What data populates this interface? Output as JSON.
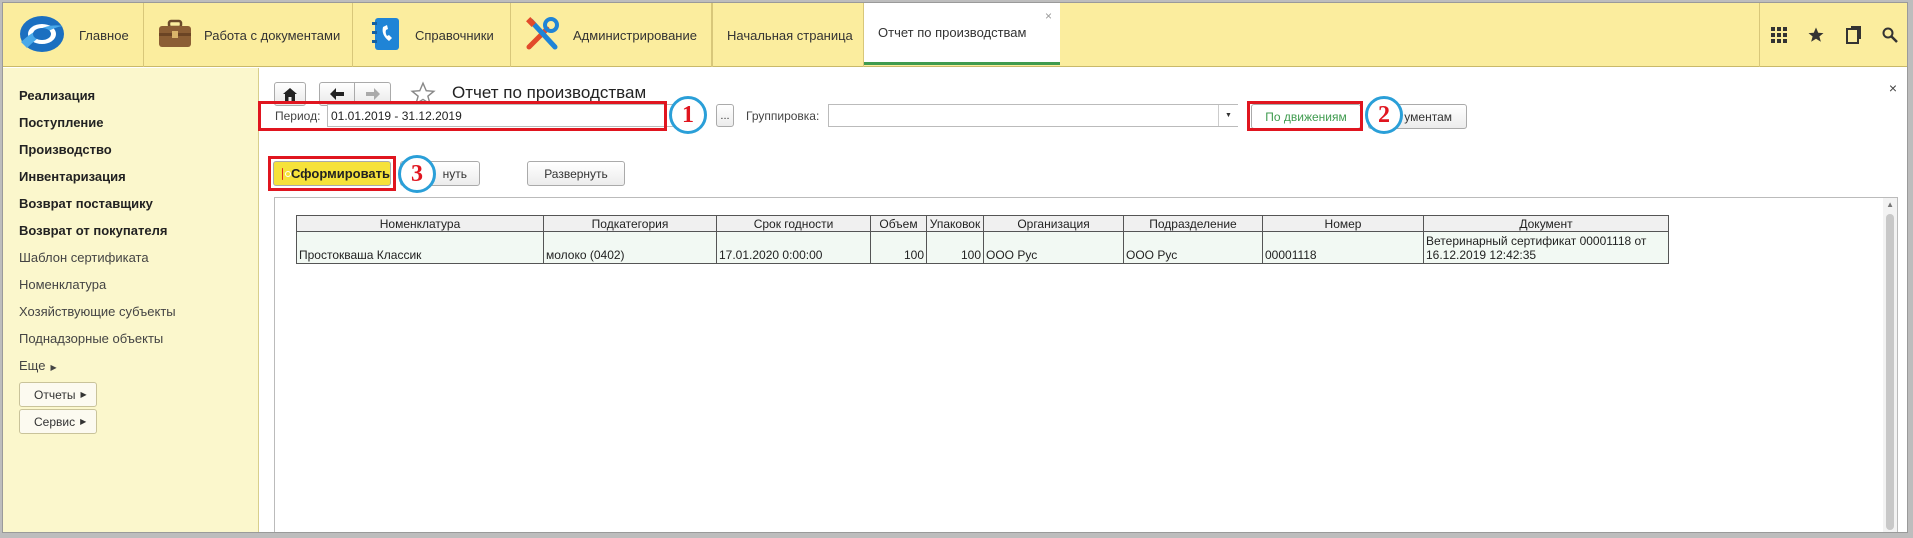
{
  "topbar": {
    "sections": [
      {
        "id": "main",
        "label": "Главное",
        "icon": "app-logo-icon"
      },
      {
        "id": "docs",
        "label": "Работа с документами",
        "icon": "briefcase-icon"
      },
      {
        "id": "refs",
        "label": "Справочники",
        "icon": "address-book-icon"
      },
      {
        "id": "admin",
        "label": "Администрирование",
        "icon": "tools-icon"
      }
    ],
    "tabs": [
      {
        "label": "Начальная страница"
      },
      {
        "label": "Отчет по производствам",
        "close": "×"
      }
    ],
    "right_icons": [
      "grid-menu-icon",
      "star-icon",
      "history-icon",
      "search-icon"
    ]
  },
  "sidebar": {
    "items": [
      {
        "label": "Реализация",
        "bold": true
      },
      {
        "label": "Поступление",
        "bold": true
      },
      {
        "label": "Производство",
        "bold": true
      },
      {
        "label": "Инвентаризация",
        "bold": true
      },
      {
        "label": "Возврат поставщику",
        "bold": true
      },
      {
        "label": "Возврат от покупателя",
        "bold": true
      },
      {
        "label": "Шаблон сертификата",
        "bold": false
      },
      {
        "label": "Номенклатура",
        "bold": false
      },
      {
        "label": "Хозяйствующие субъекты",
        "bold": false
      },
      {
        "label": "Поднадзорные объекты",
        "bold": false
      },
      {
        "label": "Еще",
        "bold": false
      }
    ],
    "buttons": [
      {
        "label": "Отчеты"
      },
      {
        "label": "Сервис"
      }
    ]
  },
  "main": {
    "title": "Отчет по производствам",
    "close": "×",
    "period_label": "Период:",
    "period_value": "01.01.2019 - 31.12.2019",
    "period_select": "...",
    "grouping_label": "Группировка:",
    "grouping_value": "",
    "btn_by_movements": "По движениям",
    "btn_by_documents_partial": "ументам",
    "btn_generate": "Сформировать",
    "btn_collapse_partial": "нуть",
    "btn_expand": "Развернуть",
    "callouts": [
      "1",
      "2",
      "3"
    ]
  },
  "table": {
    "headers": [
      "Номенклатура",
      "Подкатегория",
      "Срок годности",
      "Объем",
      "Упаковок",
      "Организация",
      "Подразделение",
      "Номер",
      "Документ"
    ],
    "rows": [
      [
        "Простокваша Классик",
        "молоко (0402)",
        "17.01.2020 0:00:00",
        "100",
        "100",
        "ООО  Рус",
        "ООО Рус",
        "00001118",
        "Ветеринарный сертификат 00001118 от 16.12.2019 12:42:35"
      ]
    ]
  },
  "colors": {
    "topbar_bg": "#fbed9e",
    "sidebar_bg": "#fbf7cc",
    "highlight_red": "#e0151f",
    "callout_blue": "#2a9fd8",
    "generate_yellow": "#f6e23a",
    "active_green": "#3f9b4f"
  }
}
